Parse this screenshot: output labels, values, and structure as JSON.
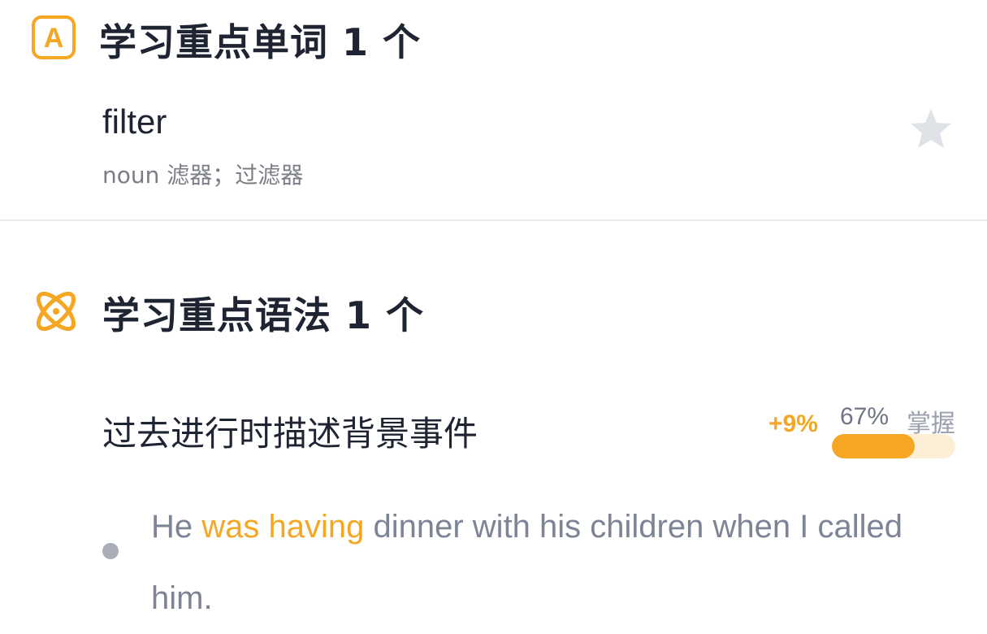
{
  "colors": {
    "accent": "#f5a623",
    "title": "#1f2433",
    "muted": "#7d8496"
  },
  "vocab": {
    "icon": "letter-a-icon",
    "title": "学习重点单词 1 个",
    "word": "filter",
    "definition": "noun 滤器；过滤器",
    "favorite_icon": "star-icon"
  },
  "grammar": {
    "icon": "atom-icon",
    "title": "学习重点语法 1 个",
    "point": "过去进行时描述背景事件",
    "delta": "+9%",
    "percent": "67%",
    "mastery_label": "掌握",
    "progress": 0.67,
    "example": {
      "before": "He ",
      "highlight": "was having",
      "after": " dinner with his children when I called him."
    }
  }
}
